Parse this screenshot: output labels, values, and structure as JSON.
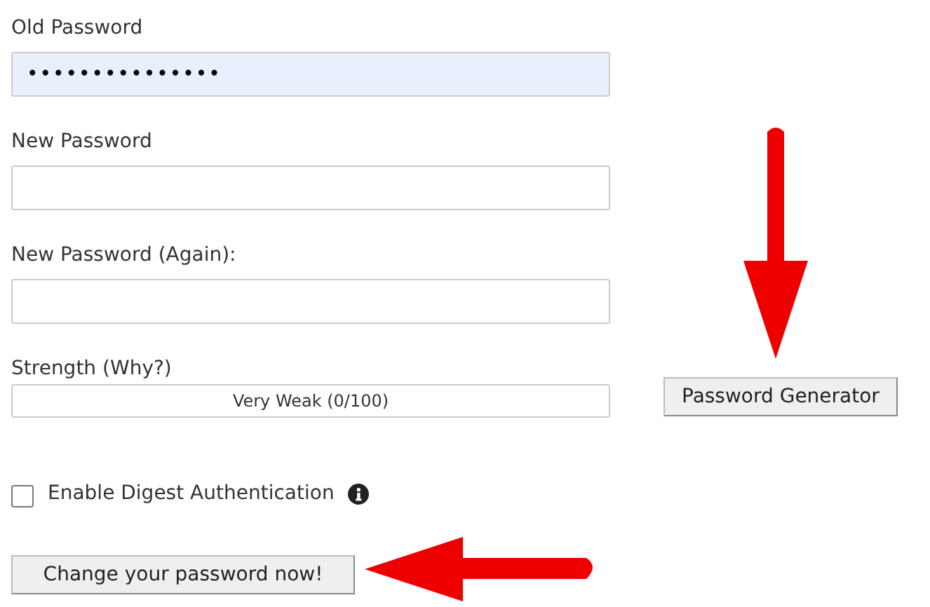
{
  "fields": [
    {
      "label": "Old Password",
      "value": "•••••••••••••••",
      "autofilled": true
    },
    {
      "label": "New Password",
      "autofilled": false
    },
    {
      "label": "New Password (Again):",
      "autofilled": false
    }
  ],
  "strength": {
    "label": "Strength (Why?)",
    "reading": "Very Weak (0/100)",
    "level": 0
  },
  "generator_button": "Password Generator",
  "digest": {
    "label": "Enable Digest Authentication",
    "checked": false
  },
  "submit_button": "Change your password now!"
}
